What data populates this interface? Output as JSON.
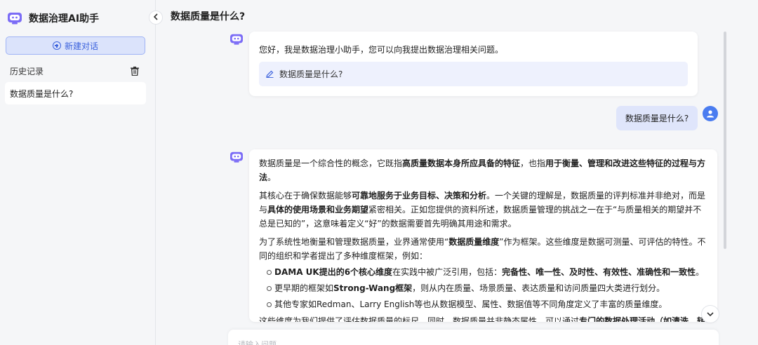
{
  "sidebar": {
    "title": "数据治理AI助手",
    "new_chat_label": "新建对话",
    "history_label": "历史记录",
    "history_items": [
      "数据质量是什么?"
    ]
  },
  "main": {
    "title": "数据质量是什么?",
    "greeting": "您好，我是数据治理小助手，您可以向我提出数据治理相关问题。",
    "suggestion": "数据质量是什么?",
    "user_message": "数据质量是什么?",
    "answer": {
      "p1": [
        "数据质量是一个综合性的概念，它既指",
        "高质量数据本身所应具备的特征",
        "，也指",
        "用于衡量、管理和改进这些特征的过程与方法",
        "。"
      ],
      "p2": [
        "其核心在于确保数据能够",
        "可靠地服务于业务目标、决策和分析",
        "。一个关键的理解是，数据质量的评判标准并非绝对，而是与",
        "具体的使用场景和业务期望",
        "紧密相关。正如您提供的资料所述，数据质量管理的挑战之一在于“与质量相关的期望并不总是已知的”，这意味着定义“好”的数据需要首先明确其用途和需求。"
      ],
      "p3": [
        "为了系统性地衡量和管理数据质量，业界通常使用“",
        "数据质量维度",
        "”作为框架。这些维度是数据可测量、可评估的特性。不同的组织和学者提出了多种维度框架，例如："
      ],
      "b1": [
        "DAMA UK提出的6个核心维度",
        "在实践中被广泛引用，包括：",
        "完备性、唯一性、及时性、有效性、准确性和一致性",
        "。"
      ],
      "b2": [
        "更早期的框架如",
        "Strong-Wang框架",
        "，则从内在质量、场景质量、表达质量和访问质量四大类进行划分。"
      ],
      "b3": "其他专家如Redman、Larry English等也从数据模型、属性、数据值等不同角度定义了丰富的质量维度。",
      "p4": [
        "这些维度为我们提供了评估数据质量的标尺。同时，数据质量并非静态属性，可以通过",
        "专门的数据处理活动（如清洗、转",
        ""
      ]
    },
    "input_placeholder": "请输入问题"
  },
  "colors": {
    "accent": "#3d63dd",
    "user_bubble": "#dfe5fb",
    "bot_icon": "#7b6cf6",
    "user_avatar": "#4a7cf0"
  }
}
